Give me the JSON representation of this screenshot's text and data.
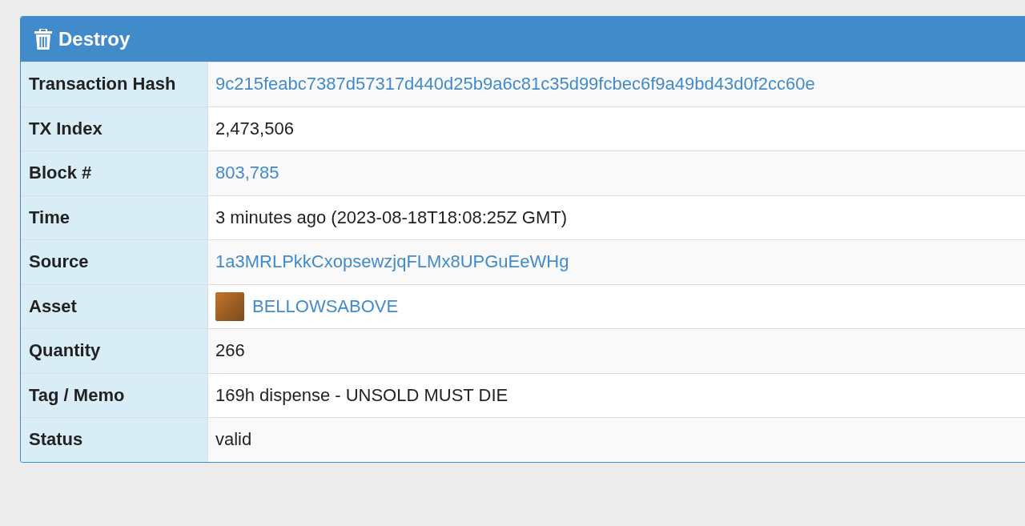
{
  "panel": {
    "title": "Destroy"
  },
  "rows": [
    {
      "label": "Transaction Hash",
      "kind": "link",
      "value": "9c215feabc7387d57317d440d25b9a6c81c35d99fcbec6f9a49bd43d0f2cc60e"
    },
    {
      "label": "TX Index",
      "kind": "text",
      "value": "2,473,506"
    },
    {
      "label": "Block #",
      "kind": "link",
      "value": "803,785"
    },
    {
      "label": "Time",
      "kind": "text",
      "value": "3 minutes ago (2023-08-18T18:08:25Z GMT)"
    },
    {
      "label": "Source",
      "kind": "link",
      "value": "1a3MRLPkkCxopsewzjqFLMx8UPGuEeWHg"
    },
    {
      "label": "Asset",
      "kind": "asset",
      "value": "BELLOWSABOVE"
    },
    {
      "label": "Quantity",
      "kind": "text",
      "value": "266"
    },
    {
      "label": "Tag / Memo",
      "kind": "text",
      "value": "169h dispense - UNSOLD MUST DIE"
    },
    {
      "label": "Status",
      "kind": "text",
      "value": "valid"
    }
  ]
}
